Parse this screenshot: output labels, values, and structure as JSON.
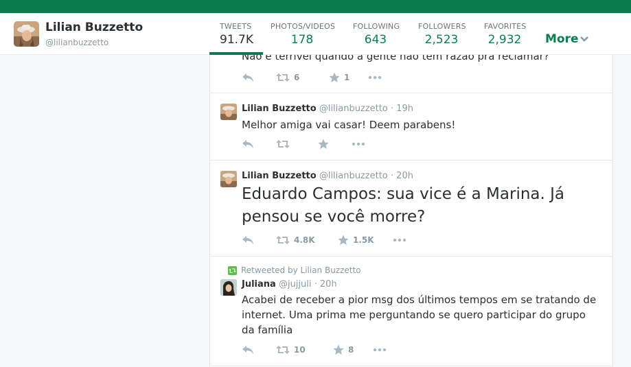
{
  "profile": {
    "name": "Lilian Buzzetto",
    "handle": "@lilianbuzzetto"
  },
  "nav": {
    "stats": [
      {
        "label": "TWEETS",
        "value": "91.7K"
      },
      {
        "label": "PHOTOS/VIDEOS",
        "value": "178"
      },
      {
        "label": "FOLLOWING",
        "value": "643"
      },
      {
        "label": "FOLLOWERS",
        "value": "2,523"
      },
      {
        "label": "FAVORITES",
        "value": "2,932"
      }
    ],
    "more_label": "More"
  },
  "tweets": [
    {
      "text": "Não é terrível quando a gente não tem razão pra reclamar?",
      "retweets": "6",
      "favorites": "1"
    },
    {
      "name": "Lilian Buzzetto",
      "handle": "@lilianbuzzetto",
      "time": "· 19h",
      "text": "Melhor amiga vai casar! Deem parabens!",
      "retweets": "",
      "favorites": ""
    },
    {
      "name": "Lilian Buzzetto",
      "handle": "@lilianbuzzetto",
      "time": "· 20h",
      "text": "Eduardo Campos: sua vice é a Marina. Já pensou se você morre?",
      "retweets": "4.8K",
      "favorites": "1.5K"
    },
    {
      "context": "Retweeted by Lilian Buzzetto",
      "name": "Juliana",
      "handle": "@jujjuli",
      "time": "· 20h",
      "text": "Acabei de receber a pior msg dos últimos tempos em se tratando de internet. Uma prima me perguntando se quero participar do grupo da família",
      "retweets": "10",
      "favorites": "8"
    }
  ],
  "colors": {
    "brand": "#0a7d4f",
    "text": "#292f33",
    "muted": "#8899a6",
    "icon": "#aab8c2",
    "border": "#e1e8ed",
    "background": "#f5f8fa"
  }
}
